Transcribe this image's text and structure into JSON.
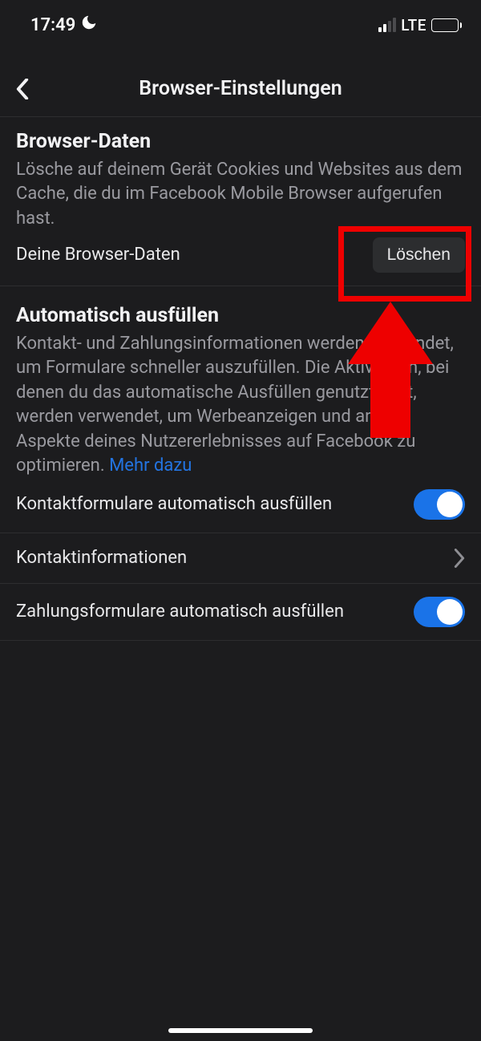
{
  "status": {
    "time": "17:49",
    "network_label": "LTE"
  },
  "nav": {
    "title": "Browser-Einstellungen"
  },
  "section_browser_data": {
    "title": "Browser-Daten",
    "description": "Lösche auf deinem Gerät Cookies und Websites aus dem Cache, die du im Facebook Mobile Browser aufgerufen hast.",
    "row_label": "Deine Browser-Daten",
    "delete_label": "Löschen"
  },
  "section_autofill": {
    "title": "Automatisch ausfüllen",
    "description": "Kontakt- und Zahlungsinformationen werden verwendet, um Formulare schneller auszufüllen. Die Aktivitäten, bei denen du das automatische Ausfüllen genutzt hast, werden verwendet, um Werbeanzeigen und andere Aspekte deines Nutzererlebnisses auf Facebook zu optimieren. ",
    "link_text": "Mehr dazu",
    "row_contact_forms": "Kontaktformulare automatisch ausfüllen",
    "row_contact_info": "Kontaktinformationen",
    "row_payment_forms": "Zahlungsformulare automatisch ausfüllen",
    "toggle_contact_forms": true,
    "toggle_payment_forms": true
  }
}
